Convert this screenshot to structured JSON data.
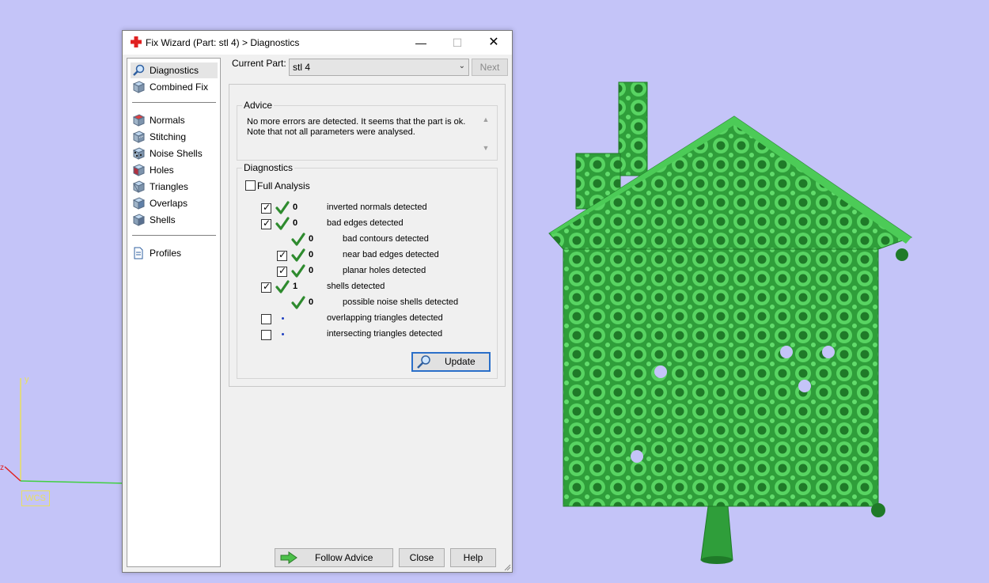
{
  "viewport": {
    "axis_y_label": "y",
    "axis_z_label": "z",
    "wcs_label": "WCS",
    "model_color": "#3fbf4a",
    "background_color": "#c4c4f8"
  },
  "window": {
    "title": "Fix Wizard (Part: stl 4) > Diagnostics",
    "app_icon": "red-cross-icon"
  },
  "nav": {
    "items": [
      {
        "label": "Diagnostics",
        "icon": "magnifier-icon",
        "selected": true
      },
      {
        "label": "Combined Fix",
        "icon": "cube-icon"
      },
      {
        "label": "Normals",
        "icon": "cube-normals-icon"
      },
      {
        "label": "Stitching",
        "icon": "cube-stitch-icon"
      },
      {
        "label": "Noise Shells",
        "icon": "noise-shells-icon"
      },
      {
        "label": "Holes",
        "icon": "cube-holes-icon"
      },
      {
        "label": "Triangles",
        "icon": "triangles-icon"
      },
      {
        "label": "Overlaps",
        "icon": "overlaps-icon"
      },
      {
        "label": "Shells",
        "icon": "shells-icon"
      },
      {
        "label": "Profiles",
        "icon": "document-icon"
      }
    ]
  },
  "top": {
    "current_part_label": "Current Part:",
    "current_part_value": "stl 4",
    "next_label": "Next"
  },
  "advice": {
    "title": "Advice",
    "text": "No more errors are detected. It seems that the part is ok.\nNote that not all parameters were analysed."
  },
  "diagnostics": {
    "title": "Diagnostics",
    "full_analysis_label": "Full Analysis",
    "full_analysis_checked": false,
    "rows": [
      {
        "checkbox": true,
        "checked": true,
        "status": "ok",
        "count": "0",
        "label": "inverted normals detected",
        "indent": 0
      },
      {
        "checkbox": true,
        "checked": true,
        "status": "ok",
        "count": "0",
        "label": "bad edges detected",
        "indent": 0
      },
      {
        "checkbox": false,
        "checked": false,
        "status": "ok",
        "count": "0",
        "label": "bad contours detected",
        "indent": 1
      },
      {
        "checkbox": true,
        "checked": true,
        "status": "ok",
        "count": "0",
        "label": "near bad edges detected",
        "indent": 1
      },
      {
        "checkbox": true,
        "checked": true,
        "status": "ok",
        "count": "0",
        "label": "planar holes detected",
        "indent": 1
      },
      {
        "checkbox": true,
        "checked": true,
        "status": "ok",
        "count": "1",
        "label": "shells detected",
        "indent": 0
      },
      {
        "checkbox": false,
        "checked": false,
        "status": "ok",
        "count": "0",
        "label": "possible noise shells detected",
        "indent": 1
      },
      {
        "checkbox": true,
        "checked": false,
        "status": "pending",
        "count": "",
        "label": "overlapping triangles detected",
        "indent": 0
      },
      {
        "checkbox": true,
        "checked": false,
        "status": "pending",
        "count": "",
        "label": "intersecting triangles detected",
        "indent": 0
      }
    ],
    "update_label": "Update"
  },
  "buttons": {
    "follow_advice": "Follow Advice",
    "close": "Close",
    "help": "Help"
  }
}
